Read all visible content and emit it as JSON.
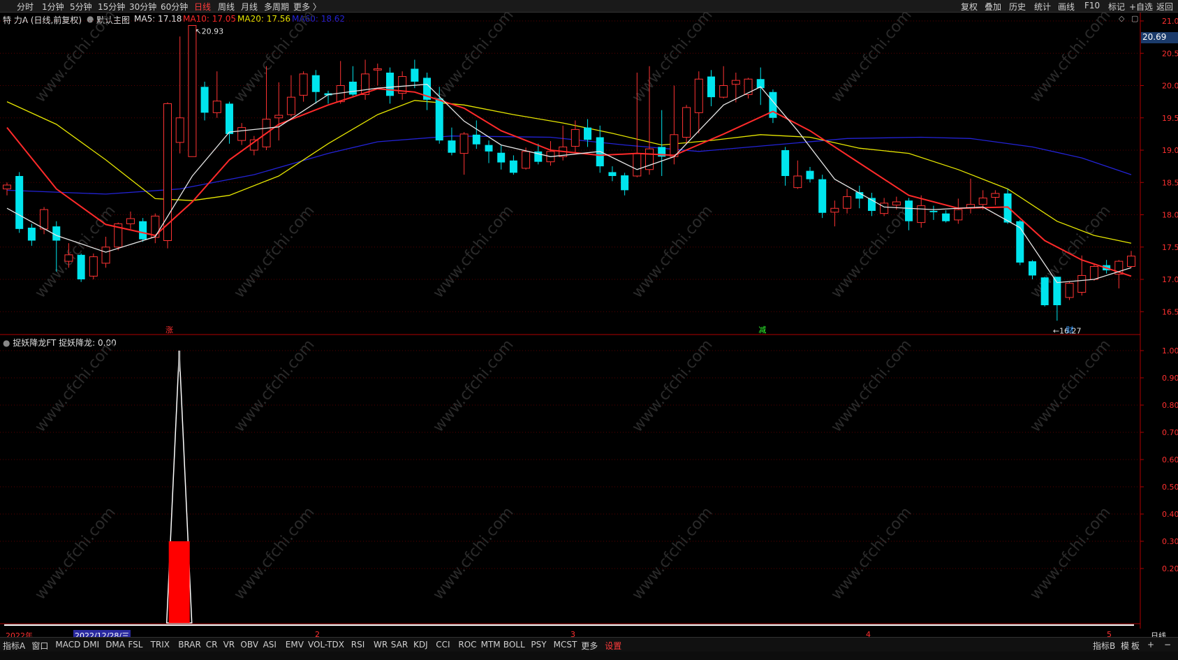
{
  "topbar": {
    "left_items": [
      "分时",
      "1分钟",
      "5分钟",
      "15分钟",
      "30分钟",
      "60分钟",
      "日线",
      "周线",
      "月线",
      "多周期",
      "更多 〉"
    ],
    "active": "日线",
    "right_items": [
      "复权",
      "叠加",
      "历史",
      "统计",
      "画线",
      "F10",
      "标记",
      "+自选",
      "返回"
    ]
  },
  "info": {
    "stock": "特 力A (日线,前复权)",
    "template": "默认主图",
    "ma5_label": "MA5: 17.18",
    "ma10_label": "MA10: 17.05",
    "ma20_label": "MA20: 17.56",
    "ma60_label": "MA60: 18.62",
    "ma5_color": "#e6e6e6",
    "ma10_color": "#ff2a2a",
    "ma20_color": "#e6e600",
    "ma60_color": "#2323d6"
  },
  "price_axis": {
    "labels": [
      "21.00",
      "20.50",
      "20.00",
      "19.50",
      "19.00",
      "18.50",
      "18.00",
      "17.50",
      "17.00",
      "16.50"
    ],
    "current_price": "20.69"
  },
  "annotations": {
    "high": "20.93",
    "low": "16.27",
    "markers": [
      {
        "text": "涨",
        "color": "#ff3030"
      },
      {
        "text": "减",
        "color": "#30ff30"
      },
      {
        "text": "财",
        "color": "#40a0ff"
      }
    ]
  },
  "indicator": {
    "title": "捉妖降龙FT",
    "value_label": "捉妖降龙: 0.00",
    "axis_labels": [
      "1.00",
      "0.90",
      "0.80",
      "0.70",
      "0.60",
      "0.50",
      "0.40",
      "0.30",
      "0.20"
    ]
  },
  "date_axis": {
    "year_label": "2022年",
    "cursor_date": "2022/12/28/三",
    "months": [
      "2",
      "3",
      "4",
      "5"
    ]
  },
  "right_bottom": {
    "label": "日线"
  },
  "bottom_tabs": [
    "指标A",
    "窗口",
    "MACD",
    "DMI",
    "DMA",
    "FSL",
    "TRIX",
    "BRAR",
    "CR",
    "VR",
    "OBV",
    "ASI",
    "EMV",
    "VOL-TDX",
    "RSI",
    "WR",
    "SAR",
    "KDJ",
    "CCI",
    "ROC",
    "MTM",
    "BOLL",
    "PSY",
    "MCST",
    "更多",
    "设置"
  ],
  "bottom_right": [
    "指标B",
    "模",
    "板",
    "+",
    "−"
  ],
  "watermark": "www.cfchi.com",
  "chart_data": {
    "type": "candlestick",
    "price_range": [
      16.2,
      21.0
    ],
    "candles": [
      [
        18.4,
        18.46,
        18.3,
        18.5
      ],
      [
        18.6,
        17.78,
        17.72,
        18.66
      ],
      [
        17.8,
        17.6,
        17.52,
        17.86
      ],
      [
        17.78,
        18.08,
        17.7,
        18.12
      ],
      [
        17.82,
        17.6,
        17.12,
        17.9
      ],
      [
        17.28,
        17.38,
        17.18,
        17.56
      ],
      [
        17.38,
        17.0,
        16.96,
        17.4
      ],
      [
        17.05,
        17.35,
        17.0,
        17.4
      ],
      [
        17.25,
        17.5,
        17.18,
        17.66
      ],
      [
        17.5,
        17.86,
        17.45,
        17.88
      ],
      [
        17.86,
        17.94,
        17.78,
        18.05
      ],
      [
        17.9,
        17.62,
        17.58,
        17.95
      ],
      [
        17.65,
        17.98,
        17.56,
        18.02
      ],
      [
        17.6,
        19.72,
        17.48,
        19.74
      ],
      [
        19.12,
        19.5,
        18.95,
        20.76
      ],
      [
        18.9,
        20.93,
        18.9,
        20.93
      ],
      [
        19.98,
        19.58,
        19.46,
        20.06
      ],
      [
        19.58,
        19.76,
        19.5,
        20.22
      ],
      [
        19.72,
        19.25,
        19.1,
        19.75
      ],
      [
        19.15,
        19.35,
        19.08,
        19.42
      ],
      [
        19.0,
        19.16,
        18.92,
        19.22
      ],
      [
        19.05,
        19.48,
        19.0,
        20.3
      ],
      [
        19.5,
        19.54,
        19.15,
        20.05
      ],
      [
        19.55,
        19.82,
        19.52,
        20.16
      ],
      [
        19.85,
        20.18,
        19.75,
        20.22
      ],
      [
        20.16,
        19.9,
        19.72,
        20.24
      ],
      [
        19.88,
        19.85,
        19.72,
        19.92
      ],
      [
        19.75,
        20.0,
        19.72,
        20.38
      ],
      [
        20.06,
        19.86,
        19.84,
        20.3
      ],
      [
        19.86,
        20.18,
        19.78,
        20.4
      ],
      [
        20.24,
        20.26,
        20.0,
        20.34
      ],
      [
        20.2,
        19.84,
        19.72,
        20.28
      ],
      [
        19.88,
        20.14,
        19.78,
        20.22
      ],
      [
        20.26,
        20.06,
        19.96,
        20.4
      ],
      [
        20.12,
        19.78,
        19.62,
        20.2
      ],
      [
        19.8,
        19.15,
        19.1,
        19.98
      ],
      [
        19.15,
        18.96,
        18.92,
        19.35
      ],
      [
        18.95,
        19.25,
        18.62,
        19.28
      ],
      [
        19.24,
        19.09,
        19.02,
        19.46
      ],
      [
        19.08,
        18.98,
        18.8,
        19.15
      ],
      [
        18.96,
        18.81,
        18.7,
        19.07
      ],
      [
        18.84,
        18.65,
        18.62,
        18.92
      ],
      [
        18.72,
        18.98,
        18.7,
        19.04
      ],
      [
        18.98,
        18.82,
        18.78,
        19.1
      ],
      [
        18.82,
        18.98,
        18.76,
        19.14
      ],
      [
        18.9,
        19.05,
        18.84,
        19.38
      ],
      [
        19.06,
        19.32,
        18.96,
        19.46
      ],
      [
        19.35,
        19.16,
        19.05,
        19.48
      ],
      [
        19.2,
        18.75,
        18.65,
        19.38
      ],
      [
        18.66,
        18.6,
        18.52,
        18.75
      ],
      [
        18.61,
        18.38,
        18.3,
        18.65
      ],
      [
        18.6,
        18.95,
        18.58,
        20.2
      ],
      [
        18.7,
        19.02,
        18.62,
        20.3
      ],
      [
        19.05,
        18.9,
        18.6,
        19.62
      ],
      [
        18.9,
        19.24,
        18.78,
        20.0
      ],
      [
        19.2,
        19.66,
        19.1,
        19.7
      ],
      [
        19.58,
        20.1,
        19.26,
        20.22
      ],
      [
        20.14,
        19.82,
        19.68,
        20.24
      ],
      [
        19.82,
        20.0,
        19.8,
        20.3
      ],
      [
        20.02,
        20.08,
        19.74,
        20.2
      ],
      [
        19.86,
        20.1,
        19.8,
        20.12
      ],
      [
        20.1,
        19.96,
        19.7,
        20.28
      ],
      [
        19.9,
        19.5,
        19.42,
        19.94
      ],
      [
        19.0,
        18.6,
        18.45,
        19.05
      ],
      [
        18.42,
        18.6,
        18.4,
        18.84
      ],
      [
        18.68,
        18.55,
        18.5,
        18.74
      ],
      [
        18.55,
        18.03,
        17.95,
        18.62
      ],
      [
        18.04,
        18.1,
        17.82,
        18.22
      ],
      [
        18.1,
        18.28,
        18.02,
        18.4
      ],
      [
        18.35,
        18.25,
        18.1,
        18.45
      ],
      [
        18.26,
        18.06,
        17.98,
        18.34
      ],
      [
        18.02,
        18.18,
        17.98,
        18.26
      ],
      [
        18.15,
        18.2,
        18.08,
        18.28
      ],
      [
        18.22,
        17.9,
        17.76,
        18.26
      ],
      [
        17.88,
        18.14,
        17.8,
        18.3
      ],
      [
        18.06,
        18.04,
        17.92,
        18.14
      ],
      [
        18.02,
        17.9,
        17.88,
        18.07
      ],
      [
        17.92,
        18.08,
        17.86,
        18.25
      ],
      [
        18.1,
        18.16,
        18.02,
        18.56
      ],
      [
        18.16,
        18.26,
        18.08,
        18.38
      ],
      [
        18.27,
        18.33,
        18.15,
        18.38
      ],
      [
        18.33,
        17.88,
        17.86,
        18.4
      ],
      [
        17.9,
        17.26,
        17.22,
        17.92
      ],
      [
        17.28,
        17.06,
        17.0,
        17.3
      ],
      [
        17.03,
        16.6,
        16.58,
        17.04
      ],
      [
        17.04,
        16.6,
        16.36,
        17.04
      ],
      [
        16.72,
        16.94,
        16.68,
        16.96
      ],
      [
        16.8,
        17.06,
        16.75,
        17.37
      ],
      [
        17.0,
        17.2,
        16.98,
        17.24
      ],
      [
        17.22,
        17.14,
        17.09,
        17.3
      ],
      [
        17.08,
        17.28,
        16.86,
        17.3
      ],
      [
        17.2,
        17.36,
        17.18,
        17.44
      ]
    ],
    "ma5": [
      [
        0,
        18.1
      ],
      [
        4,
        17.68
      ],
      [
        8,
        17.42
      ],
      [
        12,
        17.66
      ],
      [
        15,
        18.6
      ],
      [
        18,
        19.28
      ],
      [
        22,
        19.36
      ],
      [
        26,
        19.86
      ],
      [
        30,
        19.96
      ],
      [
        34,
        20.02
      ],
      [
        37,
        19.45
      ],
      [
        40,
        19.08
      ],
      [
        44,
        18.9
      ],
      [
        48,
        18.98
      ],
      [
        51,
        18.7
      ],
      [
        54,
        18.9
      ],
      [
        58,
        19.7
      ],
      [
        61,
        19.98
      ],
      [
        64,
        19.3
      ],
      [
        67,
        18.55
      ],
      [
        71,
        18.12
      ],
      [
        75,
        18.08
      ],
      [
        79,
        18.12
      ],
      [
        82,
        17.8
      ],
      [
        85,
        16.95
      ],
      [
        88,
        17.0
      ],
      [
        91,
        17.18
      ]
    ],
    "ma10": [
      [
        0,
        19.35
      ],
      [
        4,
        18.4
      ],
      [
        8,
        17.85
      ],
      [
        12,
        17.68
      ],
      [
        15,
        18.2
      ],
      [
        18,
        18.85
      ],
      [
        22,
        19.4
      ],
      [
        26,
        19.7
      ],
      [
        30,
        19.95
      ],
      [
        33,
        19.9
      ],
      [
        37,
        19.65
      ],
      [
        40,
        19.3
      ],
      [
        44,
        19.0
      ],
      [
        48,
        18.92
      ],
      [
        51,
        18.95
      ],
      [
        54,
        18.92
      ],
      [
        58,
        19.25
      ],
      [
        62,
        19.6
      ],
      [
        65,
        19.3
      ],
      [
        69,
        18.8
      ],
      [
        73,
        18.3
      ],
      [
        77,
        18.1
      ],
      [
        81,
        18.12
      ],
      [
        84,
        17.6
      ],
      [
        87,
        17.3
      ],
      [
        91,
        17.05
      ]
    ],
    "ma20": [
      [
        0,
        19.75
      ],
      [
        4,
        19.4
      ],
      [
        8,
        18.85
      ],
      [
        12,
        18.25
      ],
      [
        15,
        18.22
      ],
      [
        18,
        18.3
      ],
      [
        22,
        18.6
      ],
      [
        26,
        19.1
      ],
      [
        30,
        19.55
      ],
      [
        33,
        19.77
      ],
      [
        37,
        19.7
      ],
      [
        41,
        19.55
      ],
      [
        45,
        19.42
      ],
      [
        49,
        19.26
      ],
      [
        53,
        19.08
      ],
      [
        57,
        19.15
      ],
      [
        61,
        19.24
      ],
      [
        65,
        19.2
      ],
      [
        69,
        19.03
      ],
      [
        73,
        18.95
      ],
      [
        77,
        18.7
      ],
      [
        81,
        18.4
      ],
      [
        85,
        17.9
      ],
      [
        88,
        17.68
      ],
      [
        91,
        17.56
      ]
    ],
    "ma60": [
      [
        0,
        18.38
      ],
      [
        8,
        18.32
      ],
      [
        14,
        18.4
      ],
      [
        20,
        18.62
      ],
      [
        26,
        18.95
      ],
      [
        30,
        19.13
      ],
      [
        36,
        19.22
      ],
      [
        44,
        19.2
      ],
      [
        50,
        19.08
      ],
      [
        56,
        18.98
      ],
      [
        62,
        19.08
      ],
      [
        68,
        19.18
      ],
      [
        74,
        19.2
      ],
      [
        78,
        19.18
      ],
      [
        83,
        19.05
      ],
      [
        87,
        18.88
      ],
      [
        91,
        18.62
      ]
    ],
    "indicator_values": {
      "spike_index": 14,
      "spike_height": 1.0,
      "bar_height": 0.3
    }
  }
}
